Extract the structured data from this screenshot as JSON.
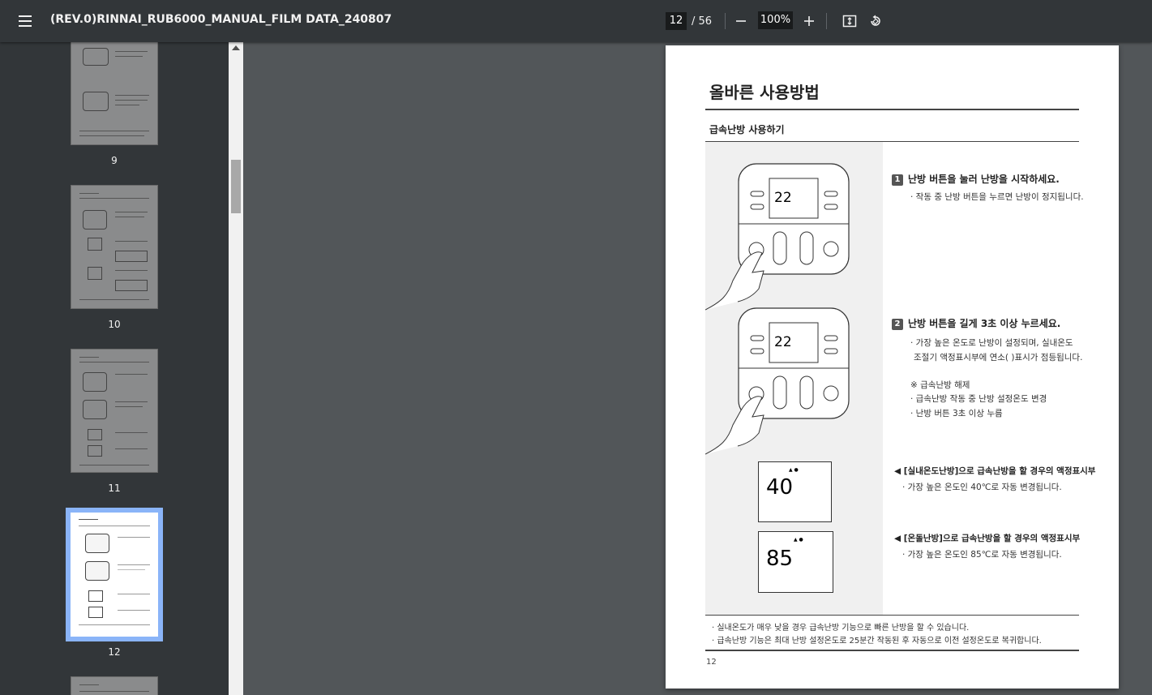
{
  "toolbar": {
    "title": "(REV.0)RINNAI_RUB6000_MANUAL_FILM DATA_240807",
    "current_page": "12",
    "total_pages": "/ 56",
    "zoom": "100%"
  },
  "icons": [
    "menu-icon",
    "zoom-out-icon",
    "zoom-in-icon",
    "fit-page-icon",
    "rotate-icon"
  ],
  "thumbnails": [
    {
      "label": "9"
    },
    {
      "label": "10"
    },
    {
      "label": "11"
    },
    {
      "label": "12"
    }
  ],
  "page": {
    "title": "올바른 사용방법",
    "subtitle": "급속난방 사용하기",
    "step1": {
      "num": "1",
      "heading": "난방 버튼을 눌러 난방을 시작하세요.",
      "text": "· 작동 중 난방 버튼을 누르면 난방이 정지됩니다."
    },
    "step2": {
      "num": "2",
      "heading": "난방 버튼을 길게 3초 이상 누르세요.",
      "line1": "· 가장 높은 온도로 난방이 설정되며, 실내온도",
      "line2": "조절기 액정표시부에 연소(  )표시가 점등됩니다.",
      "note_title": "※ 급속난방 해제",
      "note1": "· 급속난방 작동 중 난방 설정온도 변경",
      "note2": "· 난방 버튼 3초 이상 누름"
    },
    "lcd1": {
      "heading": "◀ [실내온도난방]으로 급속난방을 할 경우의 액정표시부",
      "text": "· 가장 높은 온도인 40℃로 자동 변경됩니다.",
      "value": "40"
    },
    "lcd2": {
      "heading": "◀ [온돌난방]으로 급속난방을 할 경우의 액정표시부",
      "text": "· 가장 높은 온도인 85℃로 자동 변경됩니다.",
      "value": "85"
    },
    "device_display": "22",
    "footer1": "· 실내온도가 매우 낮을 경우 급속난방 기능으로 빠른 난방을 할 수 있습니다.",
    "footer2": "· 급속난방 기능은 최대 난방 설정온도로 25분간 작동된 후 자동으로 이전 설정온도로 복귀합니다.",
    "page_number": "12"
  }
}
